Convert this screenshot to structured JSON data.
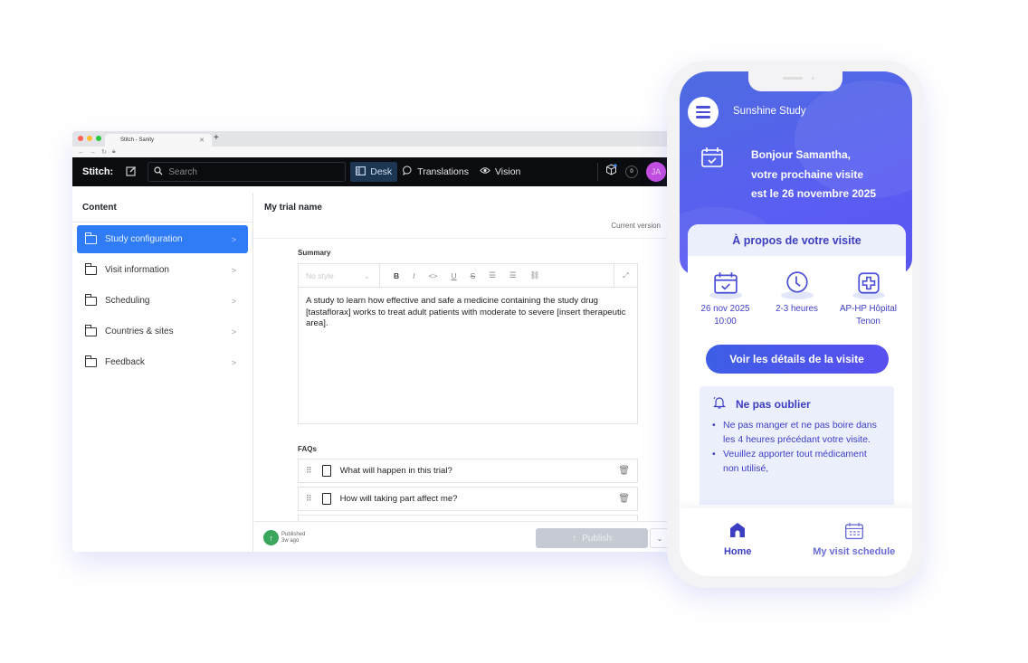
{
  "browser": {
    "tab_title": "Stitch - Sanity",
    "traffic_colors": [
      "#fe5f57",
      "#febc2e",
      "#28c840"
    ]
  },
  "studio": {
    "brand": "Stitch:",
    "search_placeholder": "Search",
    "nav": [
      {
        "label": "Desk",
        "icon": "desk-icon",
        "active": true
      },
      {
        "label": "Translations",
        "icon": "chat-bubble-icon",
        "active": false
      },
      {
        "label": "Vision",
        "icon": "eye-icon",
        "active": false
      }
    ],
    "notification_count": "0",
    "avatar_initials": "JA",
    "sidebar": {
      "title": "Content",
      "items": [
        {
          "label": "Study configuration",
          "active": true
        },
        {
          "label": "Visit information",
          "active": false
        },
        {
          "label": "Scheduling",
          "active": false
        },
        {
          "label": "Countries & sites",
          "active": false
        },
        {
          "label": "Feedback",
          "active": false
        }
      ]
    },
    "document": {
      "title": "My trial name",
      "version": "Current version",
      "summary_label": "Summary",
      "style_select": "No style",
      "toolbar": [
        "B",
        "I",
        "<>",
        "U",
        "S",
        "bullet-list",
        "numbered-list",
        "link"
      ],
      "summary_text": "A study to learn how effective and safe a medicine containing the study drug [tastaflorax] works to treat adult patients with moderate to severe [insert therapeutic area].",
      "faqs_label": "FAQs",
      "faqs": [
        "What will happen in this trial?",
        "How will taking part affect me?"
      ]
    },
    "footer": {
      "status": "Published",
      "status_time": "3w ago",
      "publish_label": "Publish"
    }
  },
  "phone": {
    "app_name": "Sunshine Study",
    "greeting": [
      "Bonjour Samantha,",
      "votre prochaine visite",
      "est le 26 novembre 2025"
    ],
    "card_title": "À propos de votre visite",
    "details": [
      {
        "icon": "calendar-check-icon",
        "line1": "26 nov 2025",
        "line2": "10:00"
      },
      {
        "icon": "clock-icon",
        "line1": "2-3 heures",
        "line2": ""
      },
      {
        "icon": "hospital-icon",
        "line1": "AP-HP Hôpital",
        "line2": "Tenon"
      }
    ],
    "cta_label": "Voir les détails de la visite",
    "reminder_title": "Ne pas oublier",
    "reminders": [
      "Ne pas manger et ne pas boire dans les 4 heures précédant votre visite.",
      "Veuillez apporter tout médicament non utilisé,"
    ],
    "tabs": [
      {
        "label": "Home",
        "active": true
      },
      {
        "label": "My visit schedule",
        "active": false
      }
    ],
    "accent": "#3c3ec2"
  }
}
